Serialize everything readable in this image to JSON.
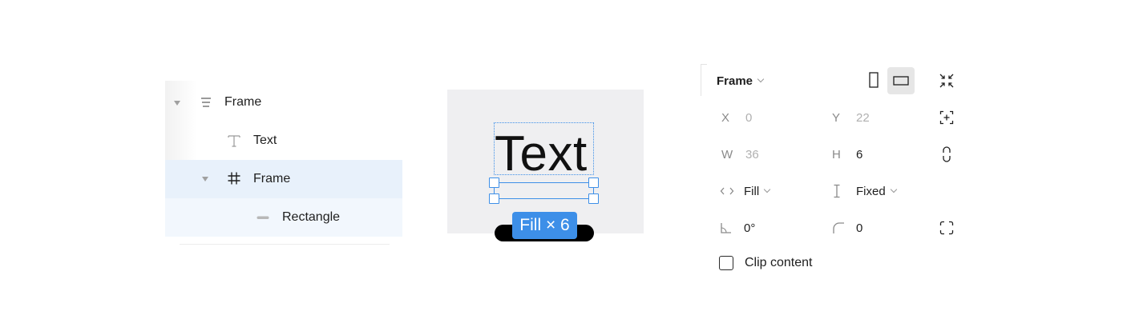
{
  "layers": {
    "items": [
      {
        "name": "Frame",
        "icon": "vertical-auto-layout-icon"
      },
      {
        "name": "Text",
        "icon": "text-icon"
      },
      {
        "name": "Frame",
        "icon": "frame-hash-icon"
      },
      {
        "name": "Rectangle",
        "icon": "rectangle-line-icon"
      }
    ]
  },
  "canvas": {
    "text": "Text",
    "size_badge": "Fill × 6"
  },
  "properties": {
    "frame_type": "Frame",
    "x": {
      "label": "X",
      "value": "0"
    },
    "y": {
      "label": "Y",
      "value": "22"
    },
    "w": {
      "label": "W",
      "value": "36"
    },
    "h": {
      "label": "H",
      "value": "6"
    },
    "width_mode": "Fill",
    "height_mode": "Fixed",
    "rotation": "0°",
    "corner_radius": "0",
    "clip_content_label": "Clip content",
    "clip_content_checked": false
  },
  "colors": {
    "selection_blue": "#3d8fe8",
    "selected_row": "#e8f1fb",
    "hover_row": "#f2f7fd",
    "canvas_bg": "#efeff1"
  }
}
